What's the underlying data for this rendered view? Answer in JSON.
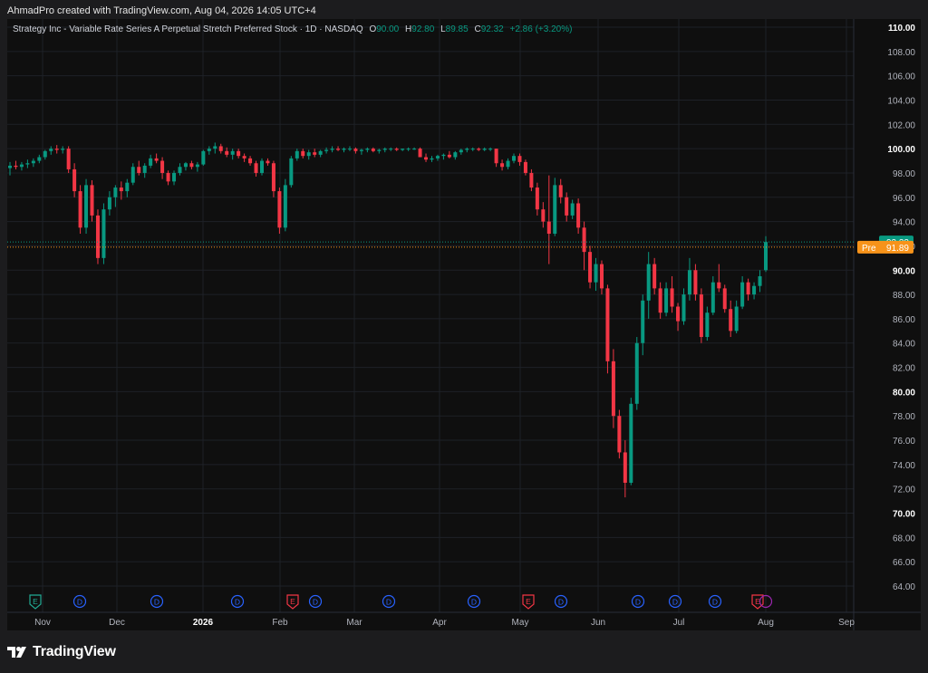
{
  "caption": "AhmadPro created with TradingView.com, Aug 04, 2026 14:05 UTC+4",
  "legend": {
    "symbol": "Strategy Inc - Variable Rate Series A Perpetual Stretch Preferred Stock · 1D · NASDAQ",
    "o_label": "O",
    "o": "90.00",
    "h_label": "H",
    "h": "92.80",
    "l_label": "L",
    "l": "89.85",
    "c_label": "C",
    "c": "92.32",
    "change": "+2.86 (+3.20%)"
  },
  "price_tags": {
    "last": "92.32",
    "pre_label": "Pre",
    "pre": "91.89"
  },
  "colors": {
    "up": "#089981",
    "down": "#f23645",
    "pre": "#f7931a",
    "earnings": "#22ab94",
    "earnings_red": "#f23645",
    "dividend": "#2962ff"
  },
  "branding": {
    "name": "TradingView",
    "logo_icon": "tradingview-logo-icon"
  },
  "chart_data": {
    "type": "candlestick",
    "title": "",
    "ylim": [
      63,
      111
    ],
    "y_ticks": [
      "110.00",
      "108.00",
      "106.00",
      "104.00",
      "102.00",
      "100.00",
      "98.00",
      "96.00",
      "94.00",
      "92.00",
      "90.00",
      "88.00",
      "86.00",
      "84.00",
      "82.00",
      "80.00",
      "78.00",
      "76.00",
      "74.00",
      "72.00",
      "70.00",
      "68.00",
      "66.00",
      "64.00"
    ],
    "bold_ticks": [
      "110.00",
      "100.00",
      "90.00",
      "80.00",
      "70.00"
    ],
    "x_ticks": [
      "Nov",
      "Dec",
      "2026",
      "Feb",
      "Mar",
      "Apr",
      "May",
      "Jun",
      "Jul",
      "Aug",
      "Sep"
    ],
    "bold_x_ticks": [
      "2026"
    ],
    "grid": true,
    "last_price": 92.32,
    "pre_price": 91.89,
    "events": [
      {
        "type": "E",
        "tone": "green"
      },
      {
        "type": "D"
      },
      {
        "type": "D"
      },
      {
        "type": "D"
      },
      {
        "type": "E",
        "tone": "red"
      },
      {
        "type": "D"
      },
      {
        "type": "D"
      },
      {
        "type": "D"
      },
      {
        "type": "E",
        "tone": "red"
      },
      {
        "type": "D"
      },
      {
        "type": "D"
      },
      {
        "type": "D"
      },
      {
        "type": "D"
      },
      {
        "type": "E",
        "tone": "red"
      }
    ],
    "candles": [
      [
        98.4,
        98.9,
        97.8,
        98.6
      ],
      [
        98.6,
        99.0,
        98.3,
        98.5
      ],
      [
        98.5,
        98.9,
        98.2,
        98.7
      ],
      [
        98.7,
        99.1,
        98.4,
        98.8
      ],
      [
        98.8,
        99.2,
        98.5,
        99.0
      ],
      [
        99.0,
        99.5,
        98.8,
        99.3
      ],
      [
        99.3,
        99.9,
        99.1,
        99.8
      ],
      [
        99.8,
        100.2,
        99.5,
        100.0
      ],
      [
        100.0,
        100.3,
        99.6,
        99.9
      ],
      [
        99.9,
        100.2,
        99.6,
        100.0
      ],
      [
        100.0,
        100.2,
        98.0,
        98.3
      ],
      [
        98.3,
        98.8,
        96.0,
        96.5
      ],
      [
        96.5,
        97.0,
        93.0,
        93.5
      ],
      [
        93.5,
        97.5,
        93.0,
        97.0
      ],
      [
        97.0,
        97.4,
        94.0,
        94.5
      ],
      [
        94.5,
        95.0,
        90.5,
        91.0
      ],
      [
        91.0,
        95.5,
        90.5,
        95.0
      ],
      [
        95.0,
        96.5,
        94.5,
        96.0
      ],
      [
        96.0,
        97.0,
        95.2,
        96.8
      ],
      [
        96.8,
        97.3,
        95.8,
        96.5
      ],
      [
        96.5,
        97.5,
        96.0,
        97.2
      ],
      [
        97.2,
        98.8,
        97.0,
        98.5
      ],
      [
        98.5,
        99.0,
        97.8,
        98.0
      ],
      [
        98.0,
        98.8,
        97.6,
        98.6
      ],
      [
        98.6,
        99.5,
        98.4,
        99.2
      ],
      [
        99.2,
        99.6,
        98.8,
        99.0
      ],
      [
        99.0,
        99.3,
        97.5,
        98.0
      ],
      [
        98.0,
        98.2,
        97.0,
        97.3
      ],
      [
        97.3,
        98.2,
        97.0,
        98.0
      ],
      [
        98.0,
        98.8,
        97.8,
        98.5
      ],
      [
        98.5,
        98.9,
        98.2,
        98.8
      ],
      [
        98.8,
        99.0,
        98.3,
        98.5
      ],
      [
        98.5,
        98.9,
        98.1,
        98.7
      ],
      [
        98.7,
        99.9,
        98.6,
        99.8
      ],
      [
        99.8,
        100.2,
        99.5,
        100.0
      ],
      [
        100.0,
        100.5,
        99.6,
        100.2
      ],
      [
        100.2,
        100.4,
        99.6,
        99.8
      ],
      [
        99.8,
        100.1,
        99.3,
        99.5
      ],
      [
        99.5,
        100.0,
        99.1,
        99.8
      ],
      [
        99.8,
        100.0,
        99.2,
        99.4
      ],
      [
        99.4,
        99.6,
        98.9,
        99.2
      ],
      [
        99.2,
        99.4,
        98.6,
        98.8
      ],
      [
        98.8,
        99.0,
        97.7,
        98.0
      ],
      [
        98.0,
        99.2,
        97.8,
        99.0
      ],
      [
        99.0,
        99.2,
        98.6,
        98.8
      ],
      [
        98.8,
        99.0,
        96.0,
        96.5
      ],
      [
        96.5,
        96.8,
        93.0,
        93.5
      ],
      [
        93.5,
        97.5,
        93.2,
        97.0
      ],
      [
        97.0,
        99.4,
        96.8,
        99.2
      ],
      [
        99.2,
        100.0,
        99.0,
        99.8
      ],
      [
        99.8,
        100.0,
        99.2,
        99.4
      ],
      [
        99.4,
        99.9,
        99.1,
        99.7
      ],
      [
        99.7,
        100.0,
        99.3,
        99.5
      ],
      [
        99.5,
        99.9,
        99.3,
        99.8
      ],
      [
        99.8,
        100.1,
        99.6,
        99.9
      ],
      [
        99.9,
        100.2,
        99.7,
        100.0
      ],
      [
        100.0,
        100.2,
        99.8,
        99.9
      ],
      [
        99.9,
        100.1,
        99.7,
        100.0
      ],
      [
        100.0,
        100.2,
        99.8,
        100.0
      ],
      [
        100.0,
        100.1,
        99.6,
        99.8
      ],
      [
        99.8,
        100.0,
        99.5,
        99.9
      ],
      [
        99.9,
        100.1,
        99.7,
        100.0
      ],
      [
        100.0,
        100.1,
        99.7,
        99.8
      ],
      [
        99.8,
        100.0,
        99.6,
        99.9
      ],
      [
        99.9,
        100.1,
        99.7,
        100.0
      ],
      [
        100.0,
        100.1,
        99.8,
        100.0
      ],
      [
        100.0,
        100.1,
        99.8,
        99.9
      ],
      [
        99.9,
        100.0,
        99.8,
        100.0
      ],
      [
        100.0,
        100.1,
        99.8,
        100.0
      ],
      [
        100.0,
        100.1,
        99.9,
        100.0
      ],
      [
        100.0,
        100.1,
        99.8,
        99.3
      ],
      [
        99.3,
        99.6,
        98.9,
        99.1
      ],
      [
        99.1,
        99.4,
        98.9,
        99.2
      ],
      [
        99.2,
        99.5,
        99.0,
        99.4
      ],
      [
        99.4,
        99.6,
        99.1,
        99.5
      ],
      [
        99.5,
        99.8,
        99.2,
        99.3
      ],
      [
        99.3,
        99.8,
        99.1,
        99.7
      ],
      [
        99.7,
        100.0,
        99.5,
        99.9
      ],
      [
        99.9,
        100.1,
        99.7,
        100.0
      ],
      [
        100.0,
        100.1,
        99.8,
        100.0
      ],
      [
        100.0,
        100.1,
        99.8,
        99.9
      ],
      [
        99.9,
        100.1,
        99.8,
        100.0
      ],
      [
        100.0,
        100.1,
        99.8,
        100.0
      ],
      [
        100.0,
        100.0,
        98.5,
        98.8
      ],
      [
        98.8,
        99.1,
        98.2,
        98.5
      ],
      [
        98.5,
        99.2,
        98.3,
        99.0
      ],
      [
        99.0,
        99.6,
        98.8,
        99.4
      ],
      [
        99.4,
        99.6,
        98.6,
        98.9
      ],
      [
        98.9,
        99.1,
        97.8,
        98.0
      ],
      [
        98.0,
        98.3,
        96.5,
        96.8
      ],
      [
        96.8,
        97.2,
        94.5,
        95.0
      ],
      [
        95.0,
        95.6,
        93.5,
        94.0
      ],
      [
        94.0,
        97.8,
        90.5,
        93.0
      ],
      [
        93.0,
        97.6,
        92.8,
        97.0
      ],
      [
        97.0,
        97.5,
        95.5,
        96.0
      ],
      [
        96.0,
        96.4,
        94.0,
        94.5
      ],
      [
        94.5,
        95.8,
        94.2,
        95.5
      ],
      [
        95.5,
        95.9,
        93.0,
        93.5
      ],
      [
        93.5,
        94.0,
        90.0,
        91.5
      ],
      [
        91.5,
        92.0,
        88.5,
        89.0
      ],
      [
        89.0,
        91.0,
        88.3,
        90.5
      ],
      [
        90.5,
        90.8,
        88.0,
        88.5
      ],
      [
        88.5,
        88.8,
        81.5,
        82.5
      ],
      [
        82.5,
        83.5,
        77.0,
        78.0
      ],
      [
        78.0,
        78.5,
        74.5,
        75.0
      ],
      [
        75.0,
        76.0,
        71.3,
        72.5
      ],
      [
        72.5,
        79.5,
        72.3,
        79.0
      ],
      [
        79.0,
        84.5,
        78.5,
        84.0
      ],
      [
        84.0,
        88.0,
        83.0,
        87.5
      ],
      [
        87.5,
        91.5,
        86.0,
        90.5
      ],
      [
        90.5,
        91.0,
        88.0,
        88.5
      ],
      [
        88.5,
        89.0,
        86.0,
        86.5
      ],
      [
        86.5,
        89.0,
        86.2,
        88.5
      ],
      [
        88.5,
        89.5,
        86.5,
        87.0
      ],
      [
        87.0,
        87.3,
        85.0,
        85.8
      ],
      [
        85.8,
        88.5,
        85.5,
        88.0
      ],
      [
        88.0,
        91.0,
        87.5,
        90.0
      ],
      [
        90.0,
        90.5,
        87.5,
        88.0
      ],
      [
        88.0,
        88.5,
        84.0,
        84.5
      ],
      [
        84.5,
        87.0,
        84.2,
        86.5
      ],
      [
        86.5,
        89.5,
        86.3,
        89.0
      ],
      [
        89.0,
        90.5,
        88.2,
        88.5
      ],
      [
        88.5,
        88.8,
        86.5,
        86.8
      ],
      [
        86.8,
        87.5,
        84.5,
        85.0
      ],
      [
        85.0,
        87.5,
        84.8,
        87.0
      ],
      [
        87.0,
        89.5,
        86.8,
        89.0
      ],
      [
        89.0,
        89.3,
        87.5,
        88.0
      ],
      [
        88.0,
        89.0,
        87.6,
        88.7
      ],
      [
        88.7,
        90.0,
        88.2,
        89.5
      ],
      [
        90.0,
        92.8,
        89.85,
        92.32
      ]
    ]
  }
}
